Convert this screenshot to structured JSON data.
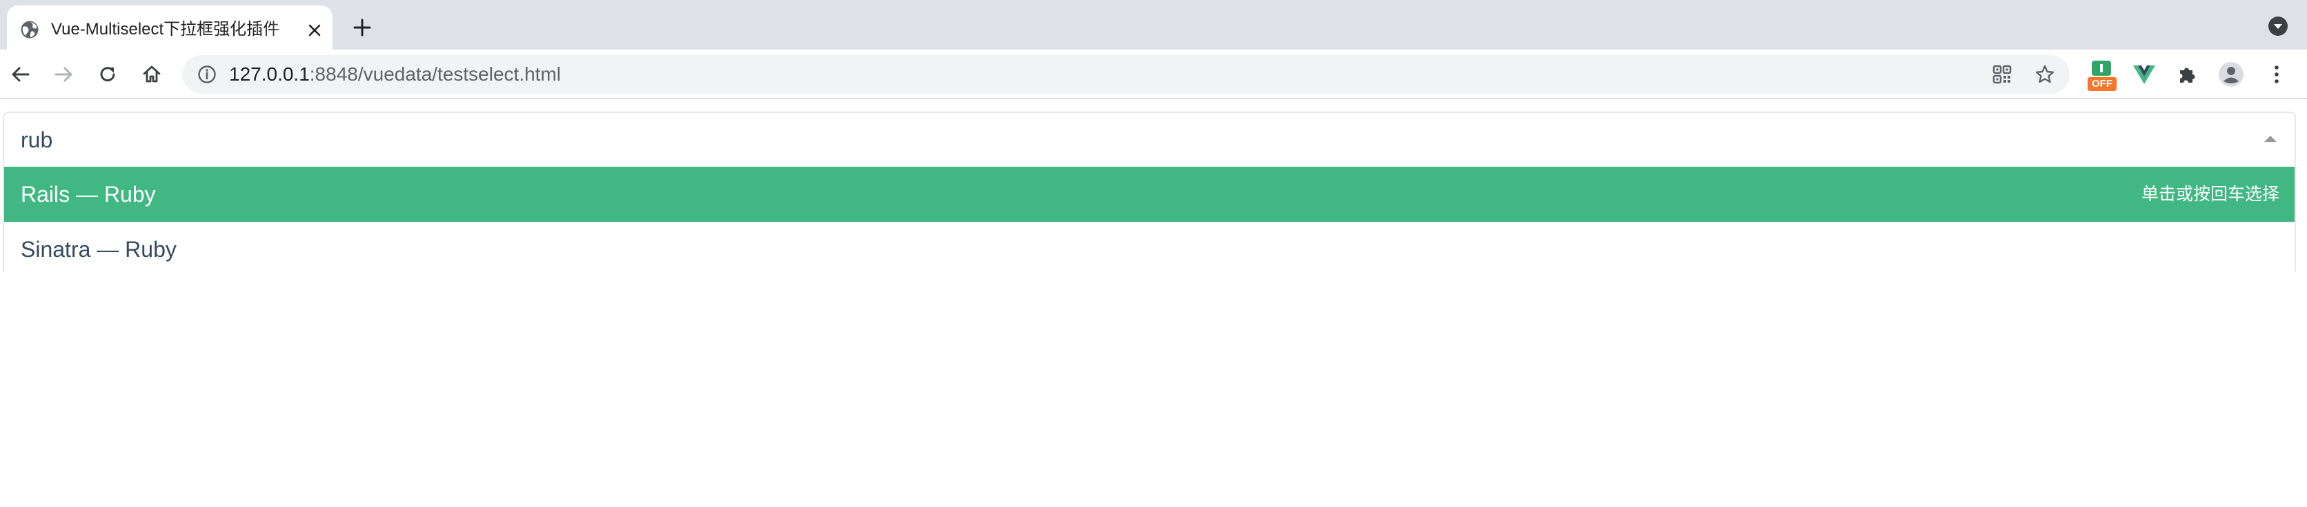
{
  "browser": {
    "tab": {
      "title": "Vue-Multiselect下拉框强化插件",
      "favicon": "globe-icon",
      "close_icon": "close-icon"
    },
    "new_tab_icon": "plus-icon",
    "tab_search_icon": "chevron-down-circle-icon",
    "nav": {
      "back_icon": "arrow-left-icon",
      "forward_icon": "arrow-right-icon",
      "reload_icon": "reload-icon",
      "home_icon": "home-icon"
    },
    "address": {
      "host": "127.0.0.1",
      "path": ":8848/vuedata/testselect.html",
      "info_icon": "info-icon",
      "qr_icon": "qr-code-icon",
      "bookmark_icon": "star-icon"
    },
    "extensions": {
      "ext1_badge": "OFF",
      "ext1_icon": "green-extension-icon",
      "vue_icon": "vue-devtools-icon",
      "puzzle_icon": "puzzle-icon",
      "profile_icon": "profile-icon",
      "menu_icon": "kebab-menu-icon"
    }
  },
  "multiselect": {
    "search_value": "rub",
    "options": [
      {
        "label": "Rails — Ruby",
        "highlighted": true,
        "hint": "单击或按回车选择"
      },
      {
        "label": "Sinatra — Ruby",
        "highlighted": false,
        "hint": ""
      }
    ],
    "colors": {
      "highlight": "#41b883",
      "text": "#35495e",
      "border": "#e8e8e8"
    }
  }
}
